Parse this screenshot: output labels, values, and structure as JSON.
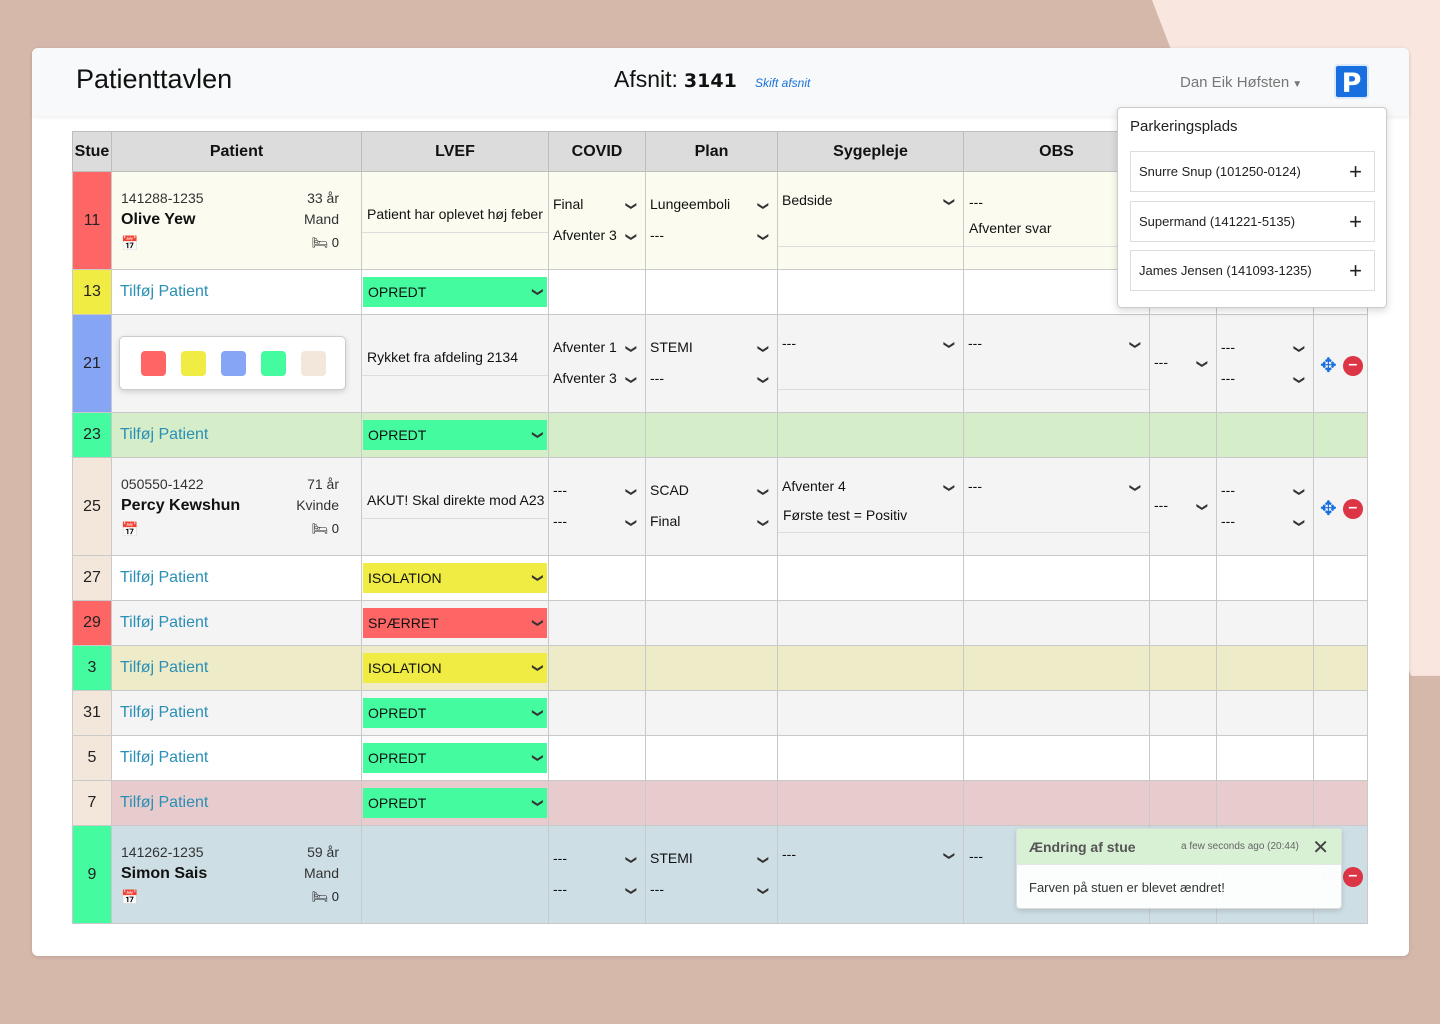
{
  "header": {
    "title": "Patienttavlen",
    "afsnit_label": "Afsnit:",
    "afsnit_number": "3141",
    "skift_afsnit": "Skift afsnit",
    "user_name": "Dan Eik Høfsten",
    "parking_button": "P"
  },
  "table": {
    "columns": [
      "Stue",
      "Patient",
      "LVEF",
      "COVID",
      "Plan",
      "Sygepleje",
      "OBS"
    ]
  },
  "rows": {
    "r11": {
      "stue": "11",
      "cpr": "141288-1235",
      "name": "Olive Yew",
      "age": "33 år",
      "sex": "Mand",
      "beds": "0",
      "note": "Patient har oplevet høj feber",
      "covid1": "Final",
      "covid2": "Afventer 3",
      "plan1": "Lungeemboli",
      "plan2": "---",
      "syge1": "Bedside",
      "obs1": "---",
      "obs2": "Afventer svar"
    },
    "r13": {
      "stue": "13",
      "add": "Tilføj Patient",
      "status": "OPREDT"
    },
    "r21": {
      "stue": "21",
      "note": "Rykket fra afdeling 2134",
      "covid1": "Afventer 1",
      "covid2": "Afventer 3",
      "plan1": "STEMI",
      "plan2": "---",
      "syge1": "---",
      "obs1": "---",
      "x1": "---",
      "y1": "---",
      "y2": "---"
    },
    "r23": {
      "stue": "23",
      "add": "Tilføj Patient",
      "status": "OPREDT"
    },
    "r25": {
      "stue": "25",
      "cpr": "050550-1422",
      "name": "Percy Kewshun",
      "age": "71 år",
      "sex": "Kvinde",
      "beds": "0",
      "note": "AKUT! Skal direkte mod A23",
      "covid1": "---",
      "covid2": "---",
      "plan1": "SCAD",
      "plan2": "Final",
      "syge1": "Afventer 4",
      "syge2": "Første test = Positiv",
      "obs1": "---",
      "x1": "---",
      "y1": "---",
      "y2": "---"
    },
    "r27": {
      "stue": "27",
      "add": "Tilføj Patient",
      "status": "ISOLATION"
    },
    "r29": {
      "stue": "29",
      "add": "Tilføj Patient",
      "status": "SPÆRRET"
    },
    "r3": {
      "stue": "3",
      "add": "Tilføj Patient",
      "status": "ISOLATION"
    },
    "r31": {
      "stue": "31",
      "add": "Tilføj Patient",
      "status": "OPREDT"
    },
    "r5": {
      "stue": "5",
      "add": "Tilføj Patient",
      "status": "OPREDT"
    },
    "r7": {
      "stue": "7",
      "add": "Tilføj Patient",
      "status": "OPREDT"
    },
    "r9": {
      "stue": "9",
      "cpr": "141262-1235",
      "name": "Simon Sais",
      "age": "59 år",
      "sex": "Mand",
      "beds": "0",
      "covid1": "---",
      "covid2": "---",
      "plan1": "STEMI",
      "plan2": "---",
      "syge1": "---",
      "obs1": "---"
    }
  },
  "colors": {
    "red": "#fe6565",
    "yellow": "#f0ec44",
    "blue": "#87a5f5",
    "green": "#44fc9f",
    "beige": "#f3e6da",
    "row_cream": "#fbfcef",
    "row_green": "#d5edc8",
    "row_yellow": "#eeecc8",
    "row_pink": "#e8cccd",
    "row_blue": "#cddfe5",
    "row_gray": "#f4f4f4"
  },
  "parking": {
    "title": "Parkeringsplads",
    "items": [
      "Snurre Snup (101250-0124)",
      "Supermand (141221-5135)",
      "James Jensen (141093-1235)"
    ]
  },
  "toast": {
    "title": "Ændring af stue",
    "time": "a few seconds ago (20:44)",
    "message": "Farven på stuen er blevet ændret!"
  }
}
